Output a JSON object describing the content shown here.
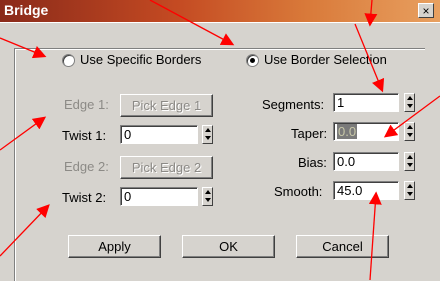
{
  "window": {
    "title": "Bridge",
    "close_label": "×"
  },
  "options": {
    "use_specific_borders": "Use Specific Borders",
    "use_border_selection": "Use Border Selection",
    "selected": "use_border_selection"
  },
  "specific": {
    "edge1_label": "Edge 1:",
    "pick_edge1": "Pick Edge 1",
    "twist1_label": "Twist 1:",
    "twist1_value": "0",
    "edge2_label": "Edge 2:",
    "pick_edge2": "Pick Edge 2",
    "twist2_label": "Twist 2:",
    "twist2_value": "0"
  },
  "params": {
    "segments_label": "Segments:",
    "segments_value": "1",
    "taper_label": "Taper:",
    "taper_value": "0.0",
    "bias_label": "Bias:",
    "bias_value": "0.0",
    "smooth_label": "Smooth:",
    "smooth_value": "45.0"
  },
  "buttons": {
    "apply": "Apply",
    "ok": "OK",
    "cancel": "Cancel"
  },
  "colors": {
    "annotation_arrow": "#ff0000",
    "title_gradient_start": "#8a2a1a",
    "dialog_bg": "#d6d3ce"
  }
}
